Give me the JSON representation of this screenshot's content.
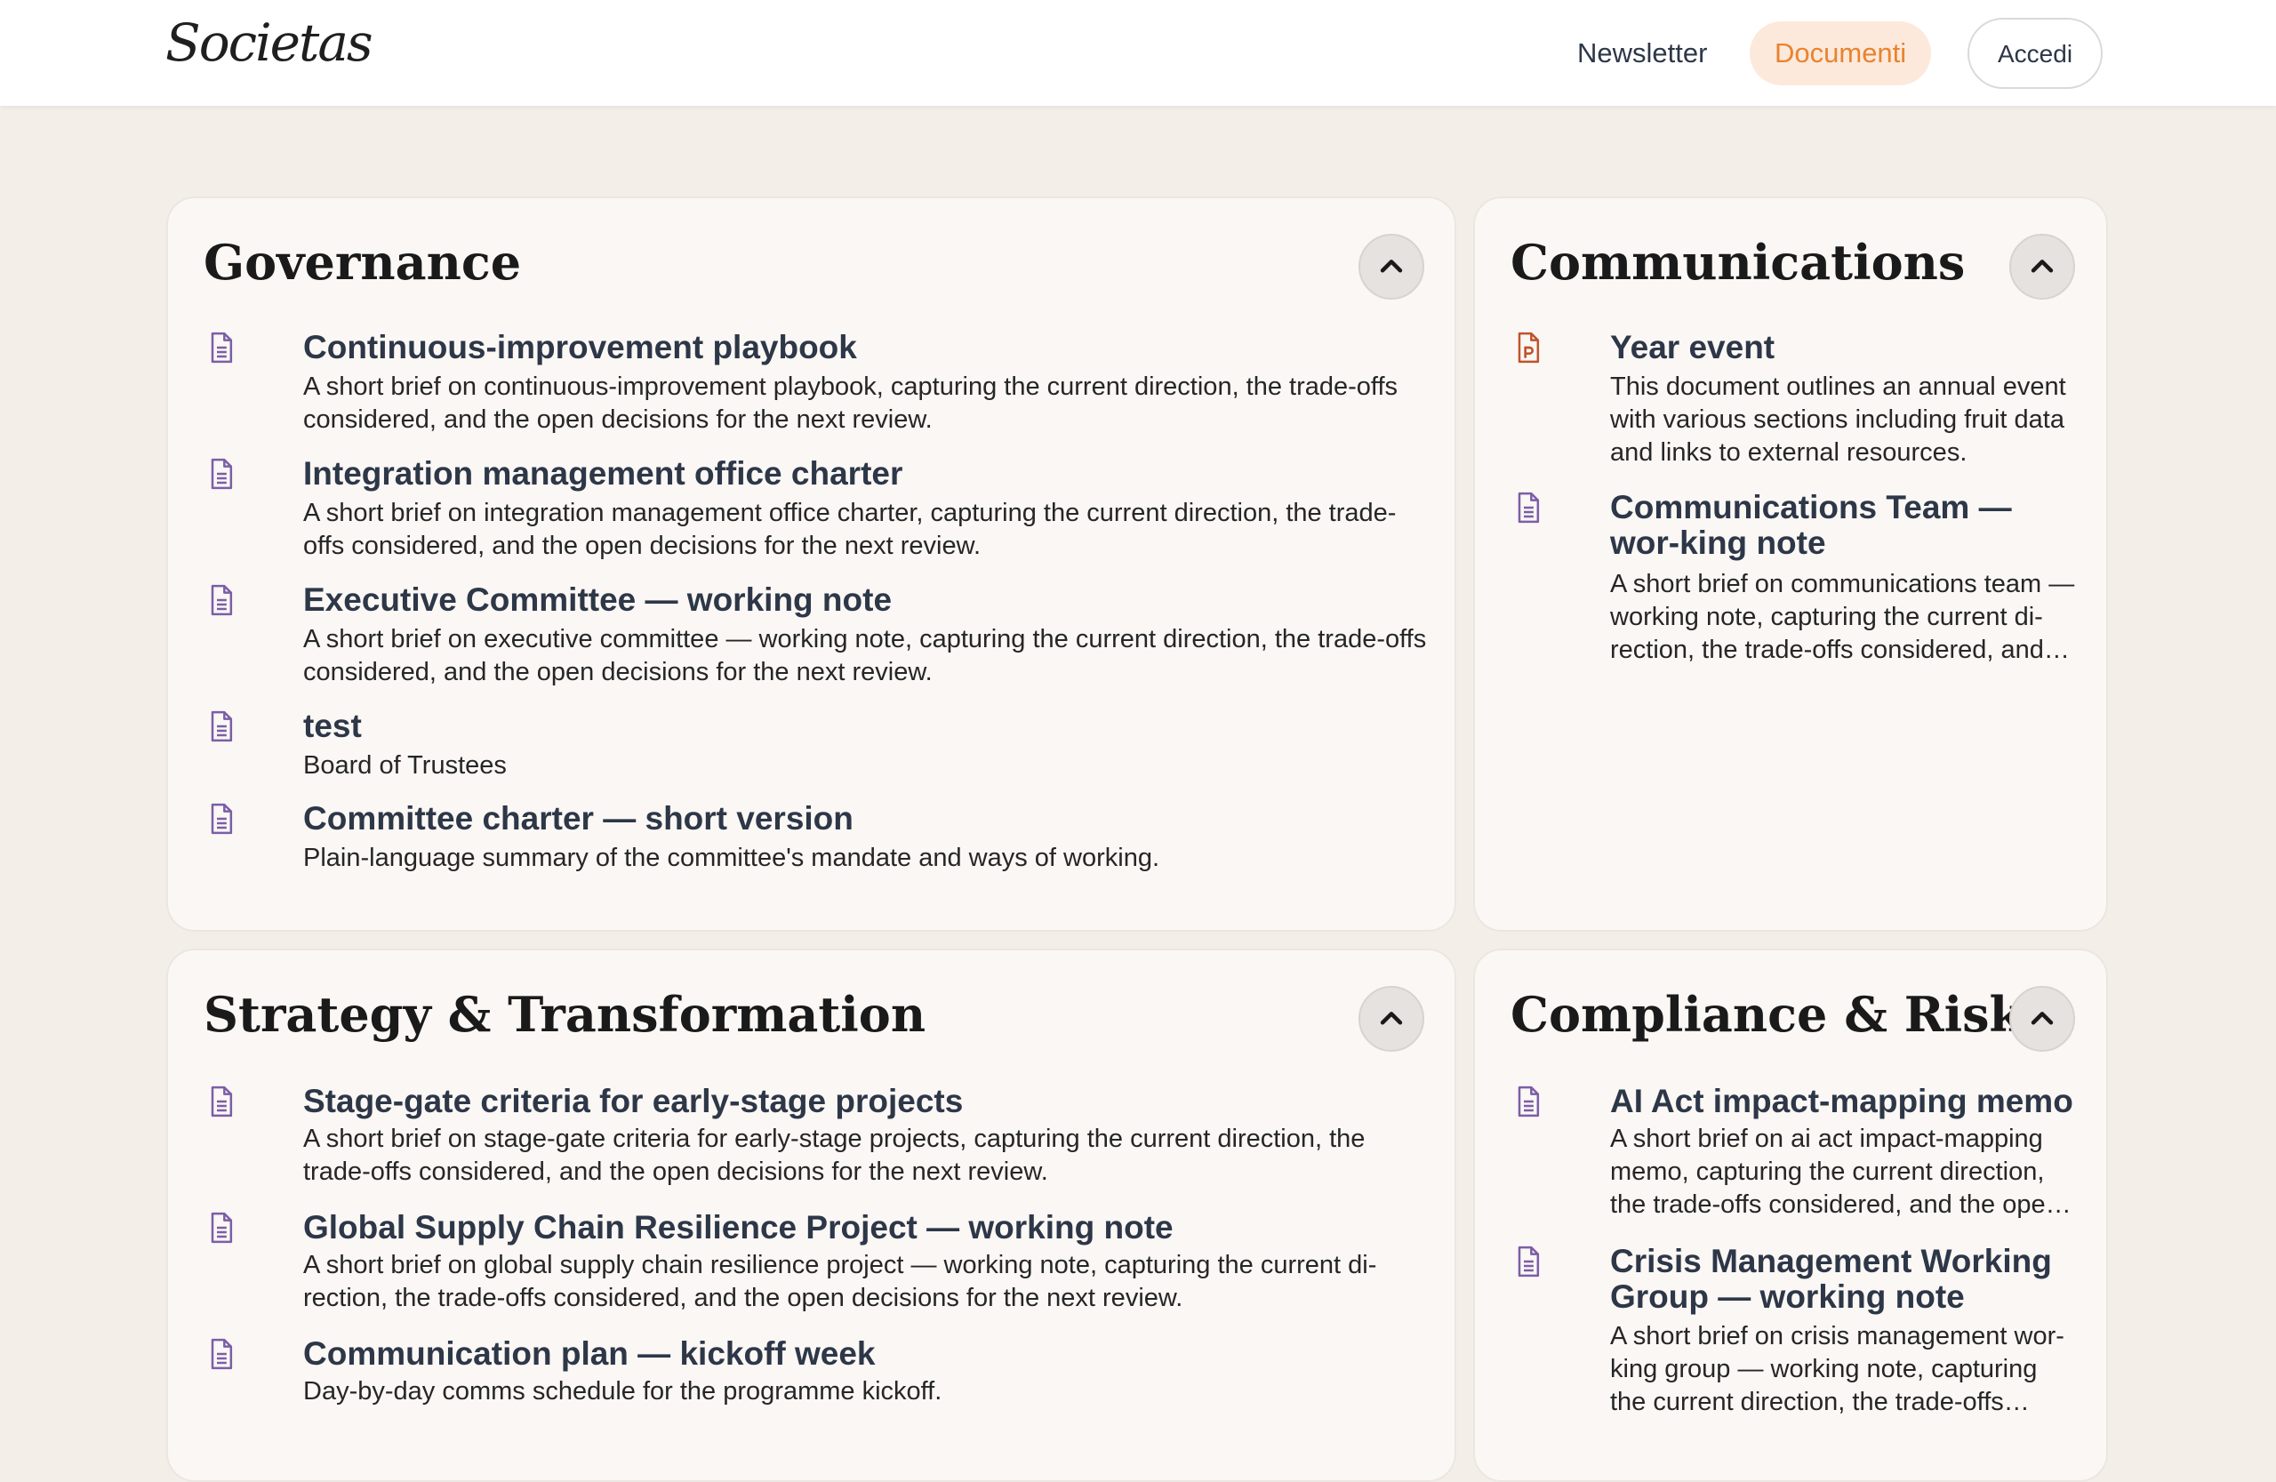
{
  "header": {
    "logo_text": "Societas",
    "nav": {
      "newsletter": "Newsletter",
      "documenti": "Documenti",
      "accedi": "Accedi"
    }
  },
  "colors": {
    "accent": "#e8832f",
    "accent_bg": "#fde9db",
    "doc_icon": "#7b5ea7",
    "ppt_icon": "#c0532b",
    "page_bg": "#f4eee9"
  },
  "sections": [
    {
      "title": "Governance",
      "collapse_icon": "chevron-up-icon",
      "items": [
        {
          "icon": "document-icon",
          "title": "Continuous-improvement playbook",
          "desc": "A short brief on continuous-improvement playbook, capturing the current direction, the trade-offs considered, and the open decisions for the next review."
        },
        {
          "icon": "document-icon",
          "title": "Integration management office charter",
          "desc": "A short brief on integration management office charter, capturing the current direction, the trade-offs considered, and the open decisions for the next review."
        },
        {
          "icon": "document-icon",
          "title": "Executive Committee — working note",
          "desc": "A short brief on executive committee — working note, capturing the current direction, the trade-offs considered, and the open decisions for the next review."
        },
        {
          "icon": "document-icon",
          "title": "test",
          "desc": "Board of Trustees"
        },
        {
          "icon": "document-icon",
          "title": "Committee charter — short version",
          "desc": "Plain-language summary of the committee's mandate and ways of working."
        }
      ]
    },
    {
      "title": "Communications",
      "collapse_icon": "chevron-up-icon",
      "items": [
        {
          "icon": "presentation-icon",
          "title": "Year event",
          "desc": "This document outlines an annual event with various sections including fruit data and links to external resources."
        },
        {
          "icon": "document-icon",
          "title": "Communications Team — wor-king note",
          "desc": "A short brief on communications team — working note, capturing the current di-rection, the trade-offs considered, and…"
        }
      ]
    },
    {
      "title": "Strategy & Transformation",
      "collapse_icon": "chevron-up-icon",
      "items": [
        {
          "icon": "document-icon",
          "title": "Stage-gate criteria for early-stage projects",
          "desc": "A short brief on stage-gate criteria for early-stage projects, capturing the current direction, the trade-offs considered, and the open decisions for the next review."
        },
        {
          "icon": "document-icon",
          "title": "Global Supply Chain Resilience Project — working note",
          "desc": "A short brief on global supply chain resilience project — working note, capturing the current di-rection, the trade-offs considered, and the open decisions for the next review."
        },
        {
          "icon": "document-icon",
          "title": "Communication plan — kickoff week",
          "desc": "Day-by-day comms schedule for the programme kickoff."
        }
      ]
    },
    {
      "title": "Compliance & Risk",
      "collapse_icon": "chevron-up-icon",
      "items": [
        {
          "icon": "document-icon",
          "title": "AI Act impact-mapping memo",
          "desc": "A short brief on ai act impact-mapping memo, capturing the current direction, the trade-offs considered, and the ope…"
        },
        {
          "icon": "document-icon",
          "title": "Crisis Management Working Group — working note",
          "desc": "A short brief on crisis management wor-king group — working note, capturing the current direction, the trade-offs consid…"
        }
      ]
    }
  ]
}
